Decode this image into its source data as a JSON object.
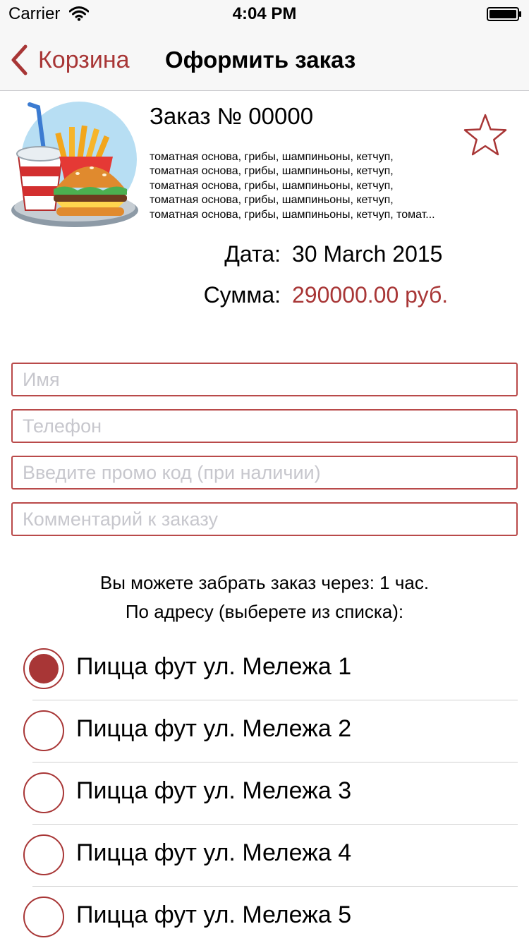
{
  "status_bar": {
    "carrier": "Carrier",
    "time": "4:04 PM"
  },
  "nav": {
    "back_label": "Корзина",
    "title": "Оформить заказ"
  },
  "order": {
    "title": "Заказ № 00000",
    "description_lines": [
      "томатная основа, грибы, шампиньоны, кетчуп,",
      "томатная основа, грибы, шампиньоны, кетчуп,",
      "томатная основа, грибы, шампиньоны, кетчуп,",
      "томатная основа, грибы, шампиньоны, кетчуп,",
      "томатная основа, грибы, шампиньоны, кетчуп, томат..."
    ],
    "date_label": "Дата:",
    "date_value": "30 March 2015",
    "sum_label": "Сумма:",
    "sum_value": "290000.00 руб."
  },
  "form": {
    "name": {
      "placeholder": "Имя",
      "value": ""
    },
    "phone": {
      "placeholder": "Телефон",
      "value": ""
    },
    "promo": {
      "placeholder": "Введите промо код (при наличии)",
      "value": ""
    },
    "comment": {
      "placeholder": "Комментарий к заказу",
      "value": ""
    }
  },
  "pickup": {
    "line1": "Вы можете забрать заказ через: 1 час.",
    "line2": "По адресу (выберете из списка):"
  },
  "addresses": {
    "selected_index": 0,
    "items": [
      {
        "label": "Пицца фут ул. Мележа 1",
        "selected": true
      },
      {
        "label": "Пицца фут ул. Мележа 2",
        "selected": false
      },
      {
        "label": "Пицца фут ул. Мележа 3",
        "selected": false
      },
      {
        "label": "Пицца фут ул. Мележа 4",
        "selected": false
      },
      {
        "label": "Пицца фут ул. Мележа 5",
        "selected": false
      }
    ]
  },
  "colors": {
    "accent": "#a83636",
    "field_border": "#b94a4a",
    "bar_background": "#f7f7f7",
    "separator": "#d0d0d0",
    "placeholder": "#c7c7cd"
  },
  "icons": {
    "status": [
      "wifi-icon",
      "battery-icon"
    ],
    "nav": "chevron-left-icon",
    "favorite": "star-icon",
    "product_image": "fast-food-icon",
    "radio": "radio-button-icon"
  }
}
